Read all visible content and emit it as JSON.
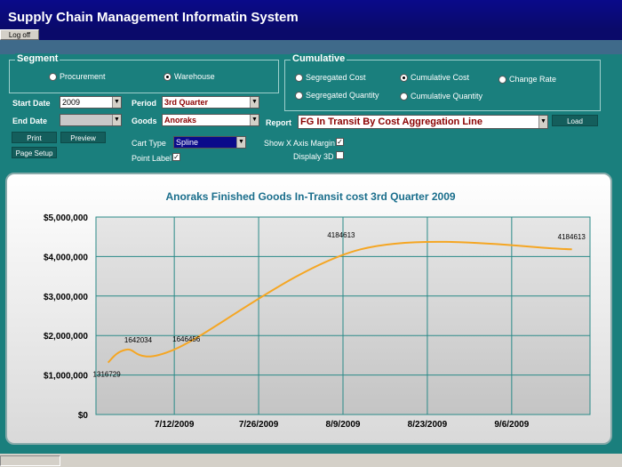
{
  "app": {
    "title": "Supply Chain Management Informatin System",
    "logoff_label": "Log off"
  },
  "segment": {
    "legend": "Segment",
    "options": [
      {
        "label": "Procurement",
        "selected": false
      },
      {
        "label": "Warehouse",
        "selected": true
      }
    ]
  },
  "cumulative": {
    "legend": "Cumulative",
    "options": [
      {
        "label": "Segregated Cost",
        "selected": false
      },
      {
        "label": "Cumulative Cost",
        "selected": true
      },
      {
        "label": "Change Rate",
        "selected": false
      },
      {
        "label": "Segregated Quantity",
        "selected": false
      },
      {
        "label": "Cumulative Quantity",
        "selected": false
      }
    ]
  },
  "form": {
    "start_date_label": "Start Date",
    "start_date_value": "2009",
    "end_date_label": "End Date",
    "end_date_value": "",
    "period_label": "Period",
    "period_value": "3rd Quarter",
    "goods_label": "Goods",
    "goods_value": "Anoraks",
    "report_label": "Report",
    "report_value": "FG In Transit By Cost Aggregation Line",
    "chart_type_label": "Cart Type",
    "chart_type_value": "Spline",
    "point_label_label": "Point Label",
    "point_label_checked": true,
    "show_x_margin_label": "Show X Axis Margin",
    "show_x_margin_checked": true,
    "display_3d_label": "Displaly 3D",
    "display_3d_checked": false
  },
  "buttons": {
    "print": "Print",
    "preview": "Preview",
    "page_setup": "Page Setup",
    "load": "Load"
  },
  "colors": {
    "panel": "#1a7f7d",
    "title_bar": "#0a0a8a",
    "series": "#f5a623",
    "grid": "#2a8a88",
    "title_text": "#1a6e8c"
  },
  "chart_data": {
    "type": "line",
    "title": "Anoraks Finished Goods In-Transit cost 3rd Quarter 2009",
    "xlabel": "",
    "ylabel": "",
    "x_ticks": [
      "7/12/2009",
      "7/26/2009",
      "8/9/2009",
      "8/23/2009",
      "9/6/2009"
    ],
    "y_ticks": [
      "$0",
      "$1,000,000",
      "$2,000,000",
      "$3,000,000",
      "$4,000,000",
      "$5,000,000"
    ],
    "ylim": [
      0,
      5000000
    ],
    "xlim": [
      "2009-06-29",
      "2009-09-19"
    ],
    "grid": true,
    "series": [
      {
        "name": "",
        "points": [
          {
            "x": "2009-07-01",
            "y": 1316729,
            "label": "1316729"
          },
          {
            "x": "2009-07-04",
            "y": 1642034,
            "label": "1642034"
          },
          {
            "x": "2009-07-12",
            "y": 1646456,
            "label": "1646456"
          },
          {
            "x": "2009-08-12",
            "y": 4184613,
            "label": "4184613"
          },
          {
            "x": "2009-09-16",
            "y": 4184613,
            "label": "4184613"
          }
        ]
      }
    ]
  }
}
